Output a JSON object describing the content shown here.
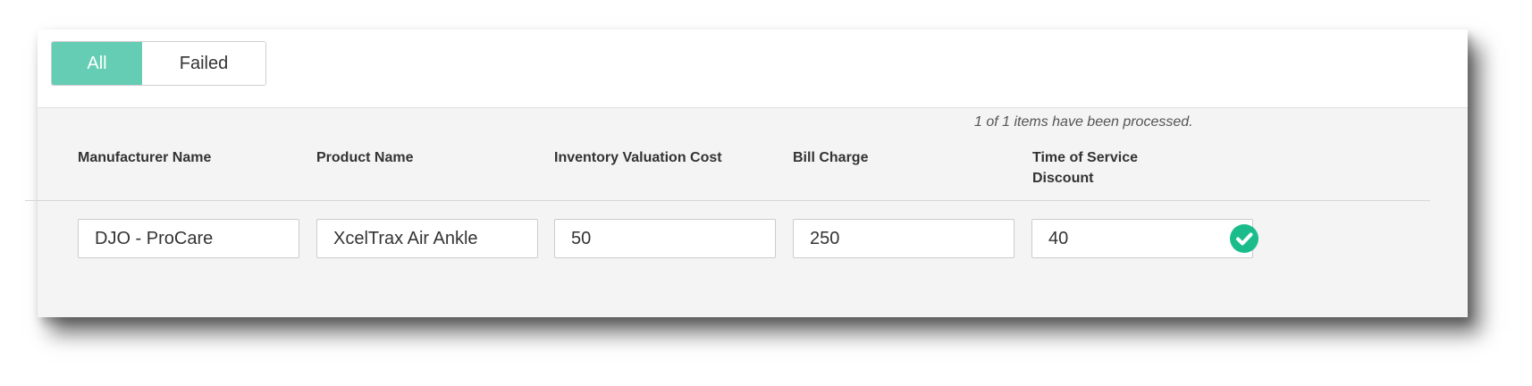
{
  "filters": {
    "all_label": "All",
    "failed_label": "Failed",
    "active": "All"
  },
  "status_message": "1 of 1 items have been processed.",
  "table": {
    "columns": [
      "Manufacturer Name",
      "Product Name",
      "Inventory Valuation Cost",
      "Bill Charge",
      "Time of Service Discount"
    ],
    "time_of_service_line1": "Time of Service",
    "time_of_service_line2": "Discount",
    "rows": [
      {
        "manufacturer": "DJO - ProCare",
        "product": "XcelTrax Air Ankle",
        "inventory_valuation_cost": "50",
        "bill_charge": "250",
        "time_of_service_discount": "40",
        "status_icon": "check-circle-icon"
      }
    ]
  },
  "colors": {
    "accent": "#66cdb5",
    "success": "#1bbc8b"
  }
}
